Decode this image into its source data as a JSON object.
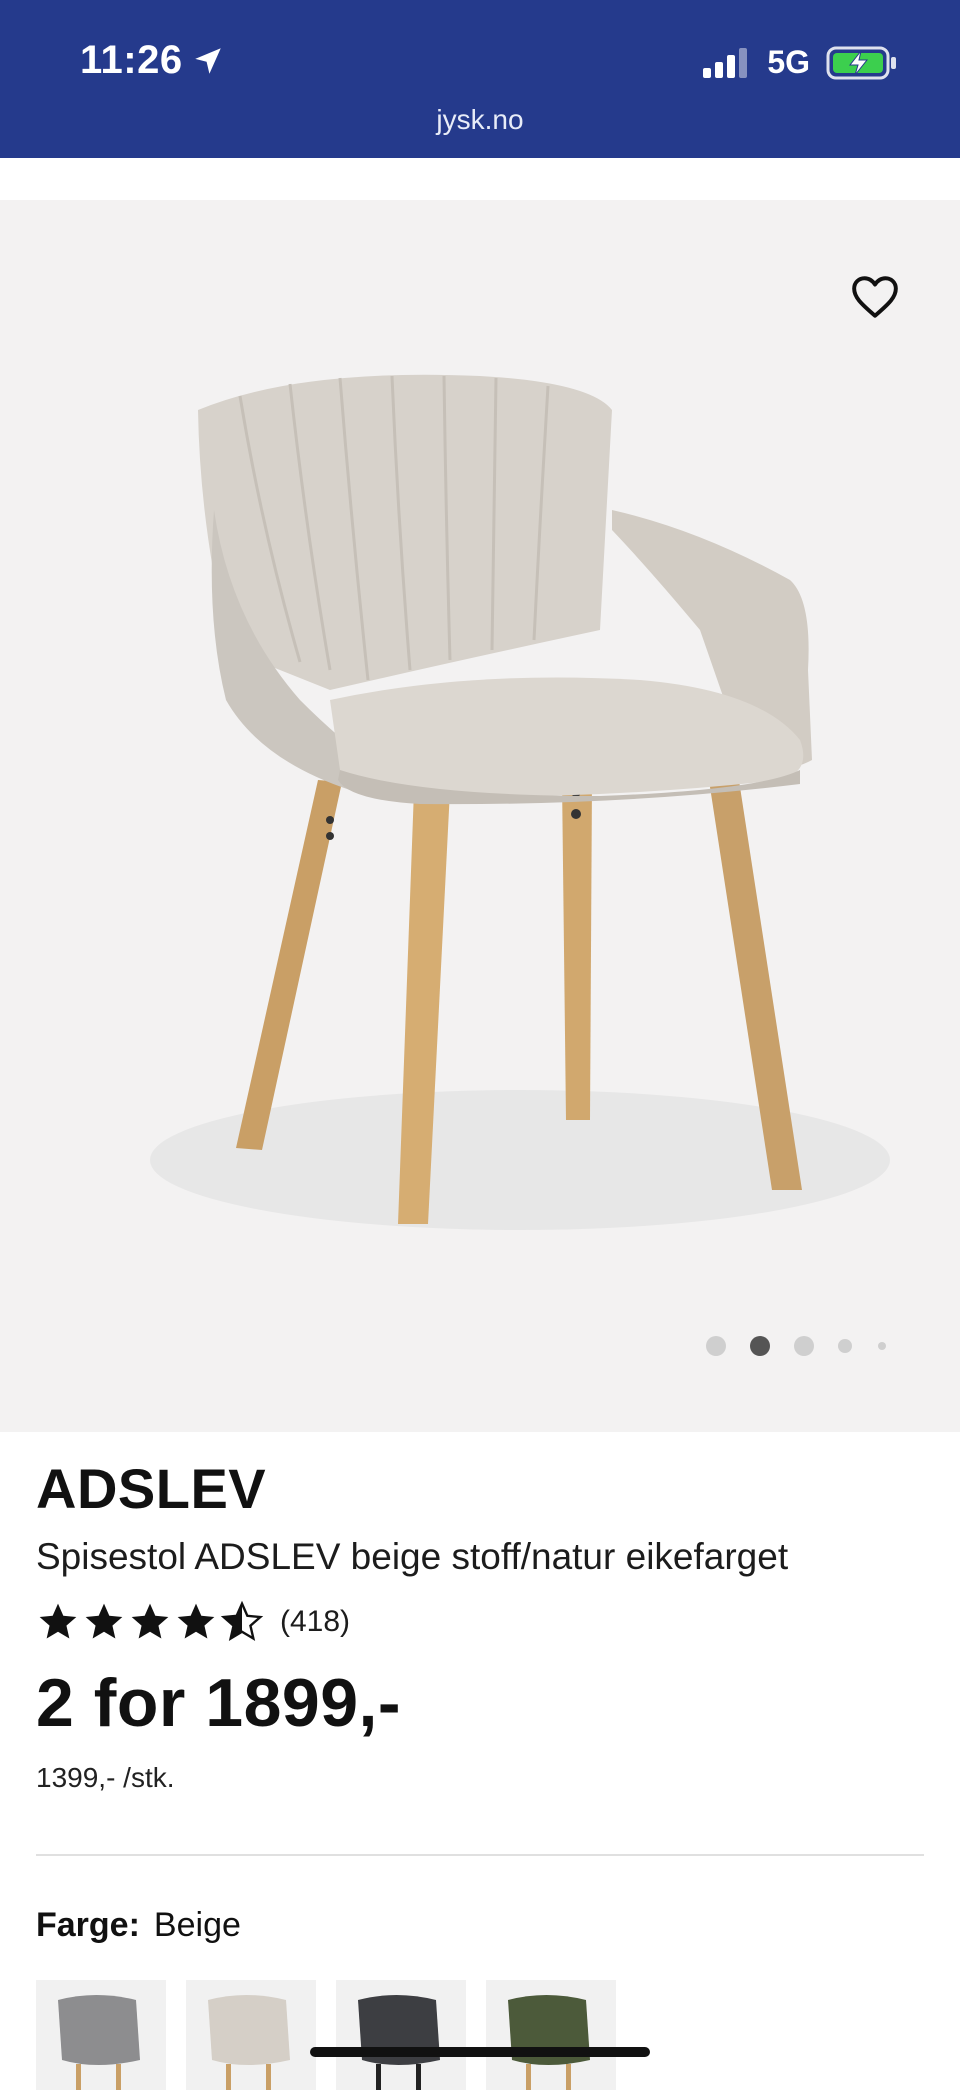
{
  "status": {
    "time": "11:26",
    "network": "5G",
    "url": "jysk.no"
  },
  "colors": {
    "brand_blue": "#253a8c",
    "battery_green": "#3ccf4e"
  },
  "product": {
    "brand": "ADSLEV",
    "title": "Spisestol ADSLEV beige stoff/natur eikefarget",
    "rating_value": 4.5,
    "rating_count": "(418)",
    "price": "2 for 1899,-",
    "unit_price": "1399,- /stk.",
    "color_label": "Farge:",
    "color_value": "Beige",
    "swatches": [
      "grey",
      "beige",
      "black",
      "olive"
    ]
  },
  "gallery": {
    "dot_count": 5,
    "active_index": 1
  }
}
